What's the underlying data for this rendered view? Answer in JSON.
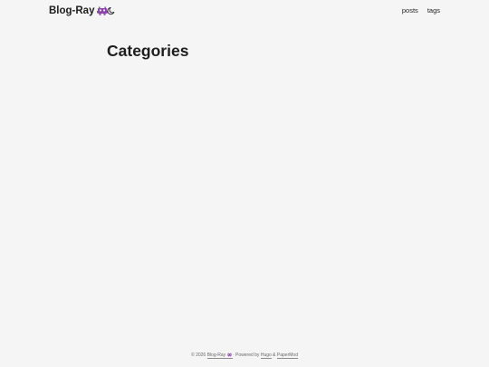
{
  "header": {
    "logo_text": "Blog-Ray",
    "logo_icon": "alien-monster-icon",
    "theme_toggle_icon": "moon-icon",
    "nav": [
      {
        "label": "posts"
      },
      {
        "label": "tags"
      }
    ]
  },
  "main": {
    "title": "Categories"
  },
  "footer": {
    "copyright": "© 2026",
    "site_link": "Blog-Ray",
    "separator": " · ",
    "powered_by": "Powered by",
    "hugo_link": "Hugo",
    "amp": "&",
    "theme_link": "PaperMod"
  },
  "colors": {
    "background": "#f5f5f5",
    "text": "#1e1e1e",
    "muted": "#6b6b6b",
    "accent": "#8e44ad"
  }
}
